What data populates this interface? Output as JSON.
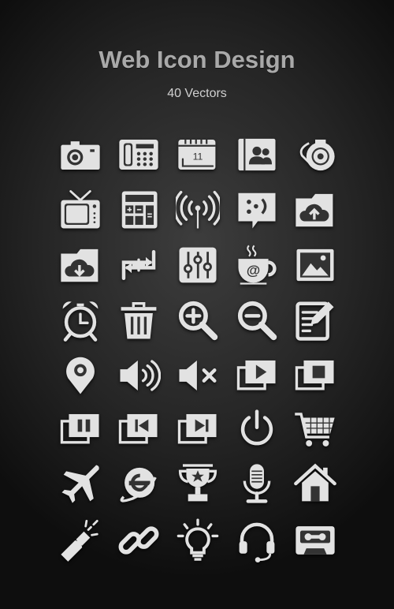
{
  "header": {
    "title": "Web Icon Design",
    "subtitle": "40 Vectors"
  },
  "colors": {
    "icon": "#e2e2e2",
    "detail": "#333333",
    "background": "#2b2b2b"
  },
  "calendar_day": "11",
  "icons": [
    "camera-icon",
    "fax-phone-icon",
    "calendar-icon",
    "contacts-book-icon",
    "webcam-icon",
    "tv-icon",
    "calculator-icon",
    "wireless-signal-icon",
    "chat-smiley-icon",
    "cloud-upload-folder-icon",
    "cloud-download-folder-icon",
    "sync-add-icon",
    "equalizer-icon",
    "coffee-email-icon",
    "image-icon",
    "alarm-clock-icon",
    "trash-icon",
    "zoom-in-icon",
    "zoom-out-icon",
    "edit-note-icon",
    "location-pin-icon",
    "volume-icon",
    "mute-icon",
    "media-play-icon",
    "media-stop-icon",
    "media-pause-icon",
    "media-previous-icon",
    "media-next-icon",
    "power-icon",
    "shopping-cart-icon",
    "airplane-icon",
    "internet-explorer-icon",
    "trophy-icon",
    "microphone-icon",
    "home-icon",
    "flashlight-icon",
    "link-icon",
    "lightbulb-icon",
    "headset-icon",
    "cassette-icon"
  ]
}
